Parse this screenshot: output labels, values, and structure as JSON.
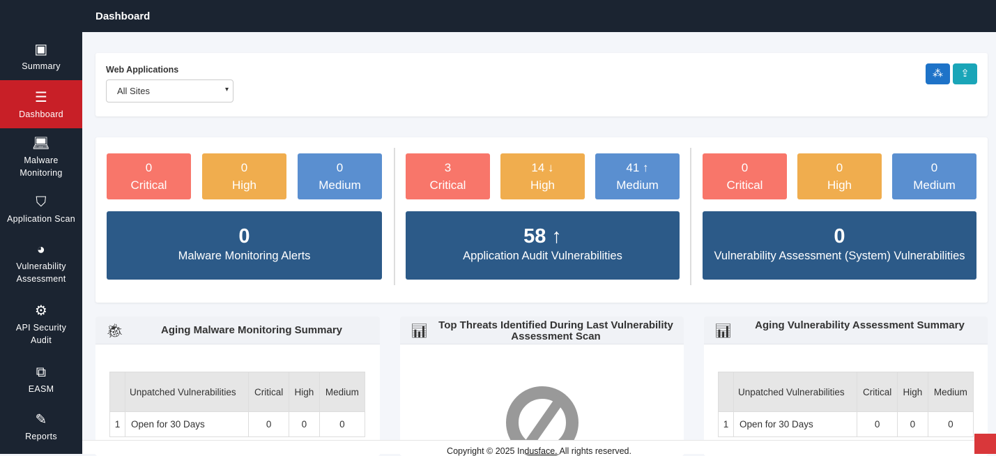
{
  "header": {
    "title": "Dashboard"
  },
  "sidebar": {
    "items": [
      {
        "label": "Summary",
        "icon": "summary-monitor-icon",
        "active": false
      },
      {
        "label": "Dashboard",
        "icon": "server-stack-icon",
        "active": true
      },
      {
        "label": "Malware Monitoring",
        "icon": "laptop-icon",
        "active": false
      },
      {
        "label": "Application Scan",
        "icon": "shield-icon",
        "active": false
      },
      {
        "label": "Vulnerability Assessment",
        "icon": "pie-chart-icon",
        "active": false
      },
      {
        "label": "API Security Audit",
        "icon": "api-chip-icon",
        "active": false
      },
      {
        "label": "EASM",
        "icon": "easm-frame-icon",
        "active": false
      },
      {
        "label": "Reports",
        "icon": "edit-report-icon",
        "active": false
      }
    ]
  },
  "filter": {
    "label": "Web Applications",
    "selected": "All Sites"
  },
  "colors": {
    "critical": "#f8766a",
    "high": "#f0ad4e",
    "medium": "#5a8fd0",
    "summary": "#2c5a88",
    "active_nav": "#c81f27"
  },
  "groups": [
    {
      "critical": "0",
      "high": "0",
      "medium": "0",
      "crit_label": "Critical",
      "high_label": "High",
      "med_label": "Medium",
      "total": "0",
      "title": "Malware Monitoring Alerts"
    },
    {
      "critical": "3",
      "high": "14 ↓",
      "medium": "41 ↑",
      "crit_label": "Critical",
      "high_label": "High",
      "med_label": "Medium",
      "total": "58 ↑",
      "title": "Application Audit Vulnerabilities"
    },
    {
      "critical": "0",
      "high": "0",
      "medium": "0",
      "crit_label": "Critical",
      "high_label": "High",
      "med_label": "Medium",
      "total": "0",
      "title": "Vulnerability Assessment (System) Vulnerabilities"
    }
  ],
  "panels": {
    "malware": {
      "title": "Aging Malware Monitoring Summary",
      "headers": [
        "",
        "Unpatched Vulnerabilities",
        "Critical",
        "High",
        "Medium"
      ],
      "rows": [
        [
          "1",
          "Open for 30 Days",
          "0",
          "0",
          "0"
        ]
      ]
    },
    "threats": {
      "title": "Top Threats Identified During Last Vulnerability Assessment Scan"
    },
    "va": {
      "title": "Aging Vulnerability Assessment Summary",
      "headers": [
        "",
        "Unpatched Vulnerabilities",
        "Critical",
        "High",
        "Medium"
      ],
      "rows": [
        [
          "1",
          "Open for 30 Days",
          "0",
          "0",
          "0"
        ]
      ]
    }
  },
  "footer": {
    "copyright": "Copyright © 2025 Indusface. All rights reserved."
  }
}
